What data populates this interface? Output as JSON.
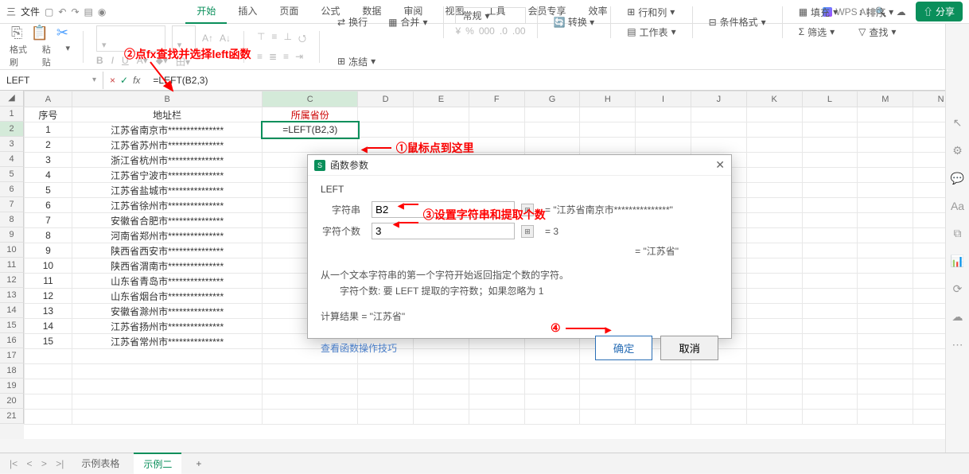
{
  "topbar": {
    "menu": "三",
    "file": "文件",
    "tabs": [
      "开始",
      "插入",
      "页面",
      "公式",
      "数据",
      "审阅",
      "视图",
      "工具",
      "会员专享",
      "效率"
    ],
    "active_tab_index": 0,
    "wps_ai": "WPS AI",
    "cloud_icon": "☁",
    "share": "分享"
  },
  "ribbon": {
    "group1": {
      "label1": "格式刷",
      "label2": "粘贴"
    },
    "pills": [
      "常规",
      "换行",
      "合并",
      "行和列",
      "工作表",
      "条件格式",
      "填充",
      "排序",
      "冻结",
      "求和",
      "筛选",
      "查找"
    ]
  },
  "formula": {
    "name_box": "LEFT",
    "cancel": "×",
    "confirm": "✓",
    "fx": "fx",
    "input": "=LEFT(B2,3)"
  },
  "sheet": {
    "cols": [
      "A",
      "B",
      "C",
      "D",
      "E",
      "F",
      "G",
      "H",
      "I",
      "J",
      "K",
      "L",
      "M",
      "N"
    ],
    "header_row": {
      "A": "序号",
      "B": "地址栏",
      "C": "所属省份"
    },
    "editing_cell": "=LEFT(B2,3)",
    "rows": [
      {
        "n": "1",
        "addr": "江苏省南京市***************"
      },
      {
        "n": "2",
        "addr": "江苏省苏州市***************"
      },
      {
        "n": "3",
        "addr": "浙江省杭州市***************"
      },
      {
        "n": "4",
        "addr": "江苏省宁波市***************"
      },
      {
        "n": "5",
        "addr": "江苏省盐城市***************"
      },
      {
        "n": "6",
        "addr": "江苏省徐州市***************"
      },
      {
        "n": "7",
        "addr": "安徽省合肥市***************"
      },
      {
        "n": "8",
        "addr": "河南省郑州市***************"
      },
      {
        "n": "9",
        "addr": "陕西省西安市***************"
      },
      {
        "n": "10",
        "addr": "陕西省渭南市***************"
      },
      {
        "n": "11",
        "addr": "山东省青岛市***************"
      },
      {
        "n": "12",
        "addr": "山东省烟台市***************"
      },
      {
        "n": "13",
        "addr": "安徽省滁州市***************"
      },
      {
        "n": "14",
        "addr": "江苏省扬州市***************"
      },
      {
        "n": "15",
        "addr": "江苏省常州市***************"
      }
    ]
  },
  "dialog": {
    "title": "函数参数",
    "func": "LEFT",
    "param1_label": "字符串",
    "param1_value": "B2",
    "param1_preview": "= \"江苏省南京市***************\"",
    "param2_label": "字符个数",
    "param2_value": "3",
    "param2_preview": "= 3",
    "result_preview": "= \"江苏省\"",
    "desc1": "从一个文本字符串的第一个字符开始返回指定个数的字符。",
    "desc2": "字符个数: 要 LEFT 提取的字符数；如果忽略为 1",
    "calc_result": "计算结果 = \"江苏省\"",
    "help_link": "查看函数操作技巧",
    "ok": "确定",
    "cancel": "取消"
  },
  "annotations": {
    "a1": "①鼠标点到这里",
    "a2": "②点fx查找并选择left函数",
    "a3": "③设置字符串和提取个数",
    "a4": "④"
  },
  "sheet_tabs": {
    "tab1": "示例表格",
    "tab2": "示例二",
    "add": "+"
  }
}
